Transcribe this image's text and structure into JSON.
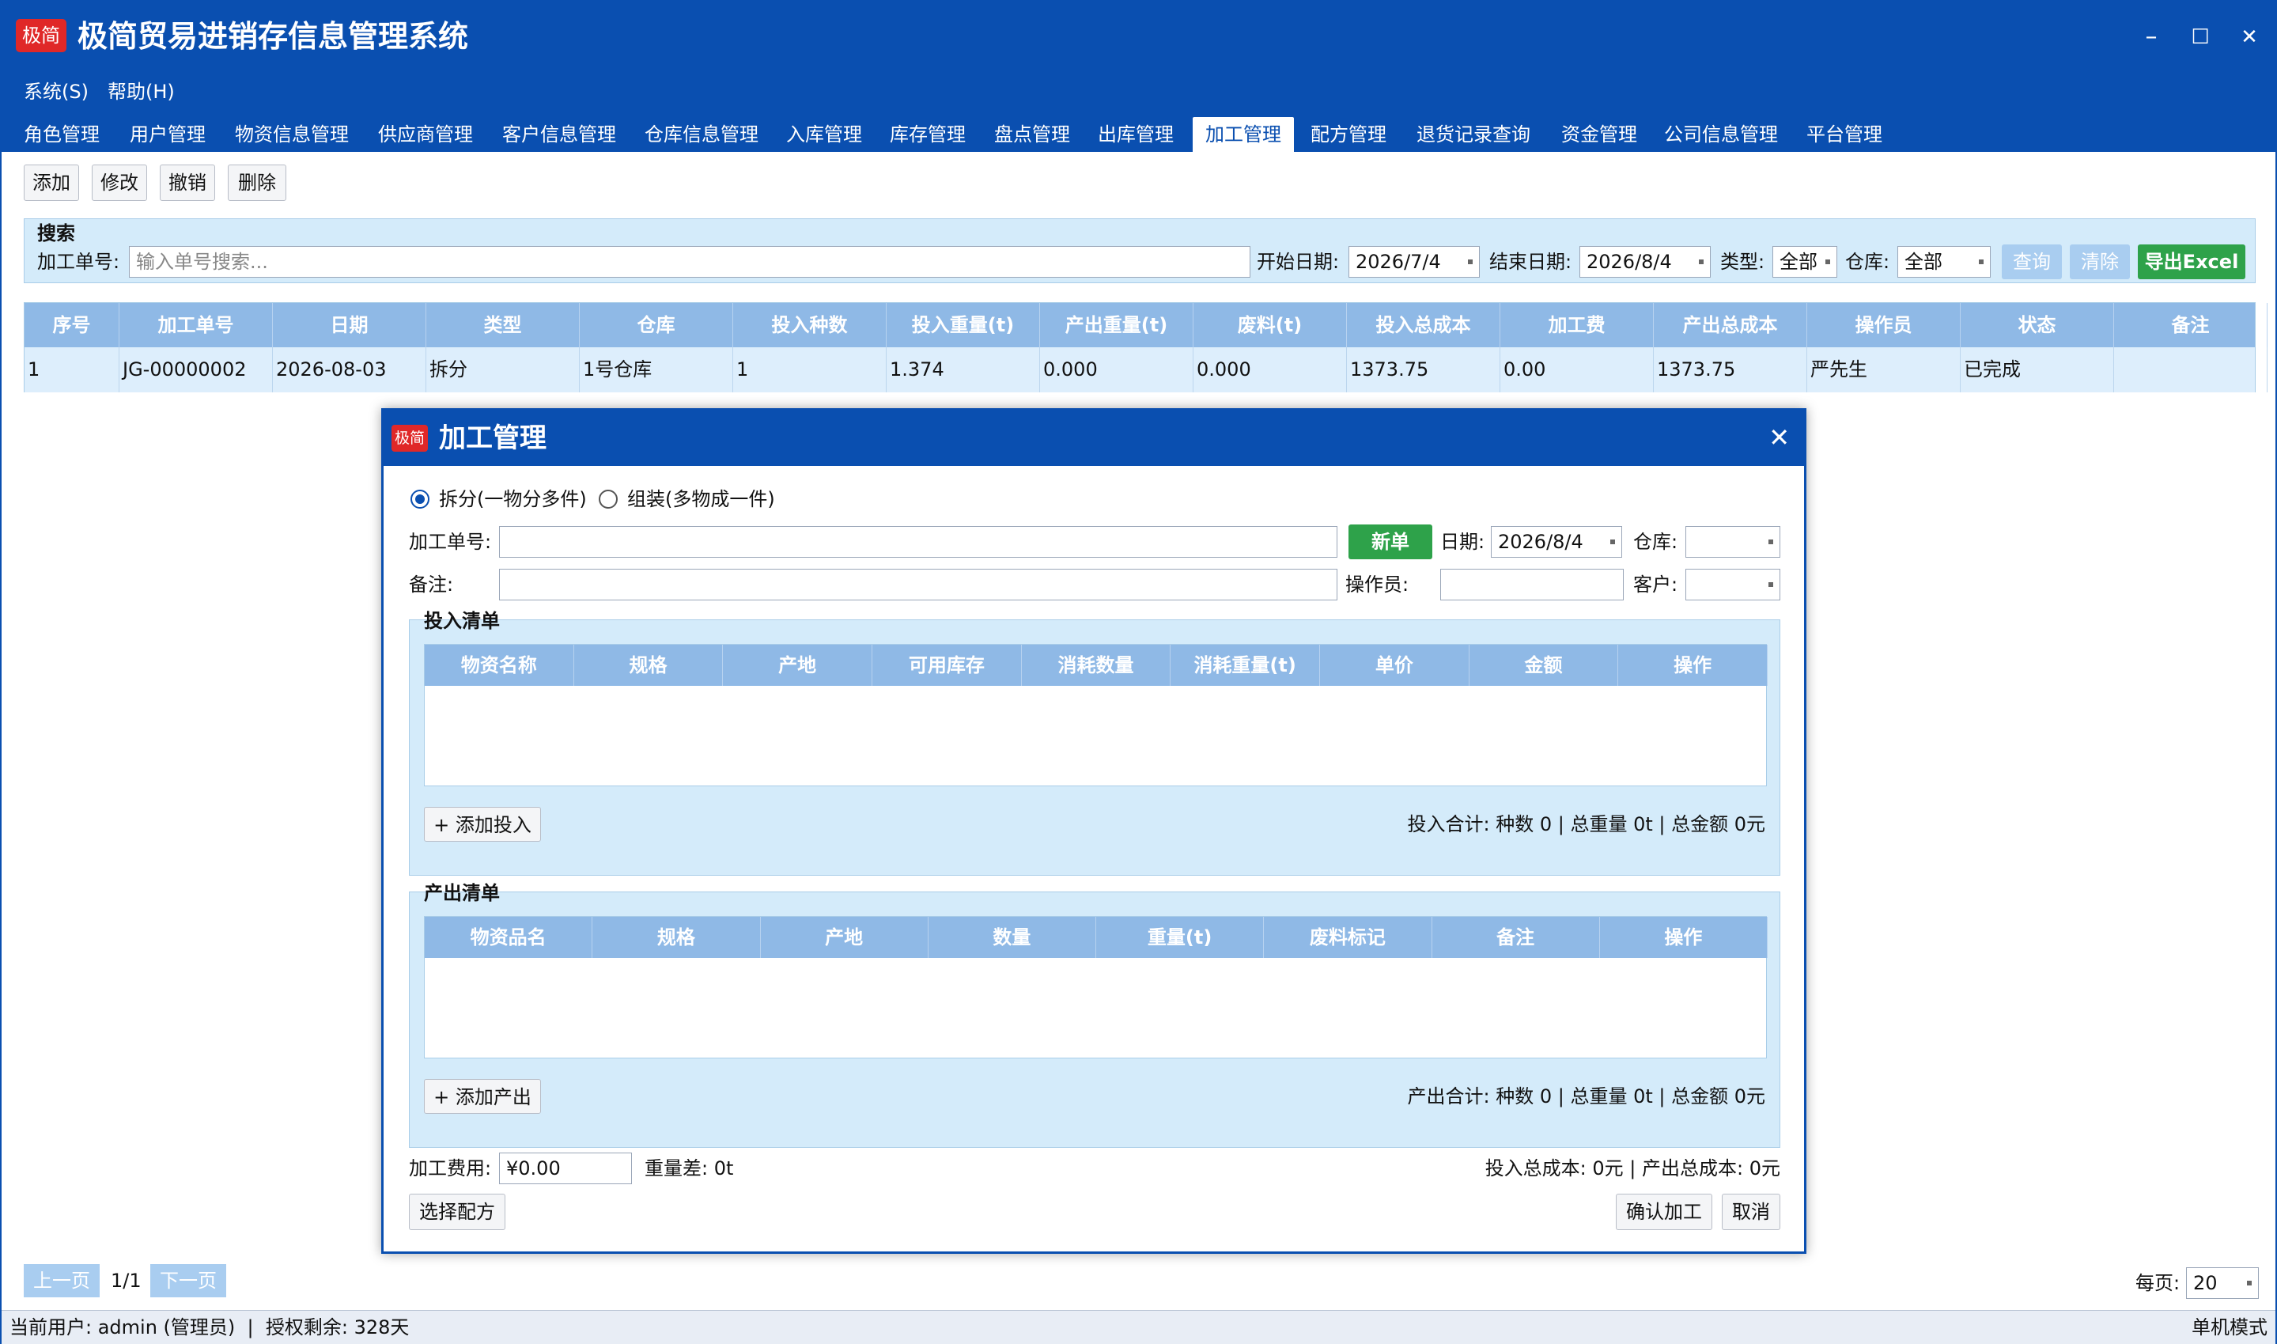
{
  "app": {
    "logo": "极简",
    "title": "极简贸易进销存信息管理系统",
    "win_min": "–",
    "win_max": "☐",
    "win_close": "✕"
  },
  "menu": [
    "系统(S)",
    "帮助(H)"
  ],
  "tabs": [
    "角色管理",
    "用户管理",
    "物资信息管理",
    "供应商管理",
    "客户信息管理",
    "仓库信息管理",
    "入库管理",
    "库存管理",
    "盘点管理",
    "出库管理",
    "加工管理",
    "配方管理",
    "退货记录查询",
    "资金管理",
    "公司信息管理",
    "平台管理"
  ],
  "active_tab": "加工管理",
  "toolbar": [
    "添加",
    "修改",
    "撤销",
    "删除"
  ],
  "search": {
    "title": "搜索",
    "order_label": "加工单号:",
    "order_placeholder": "输入单号搜索...",
    "start_label": "开始日期:",
    "start_value": "2026/7/4",
    "end_label": "结束日期:",
    "end_value": "2026/8/4",
    "type_label": "类型:",
    "type_value": "全部",
    "wh_label": "仓库:",
    "wh_value": "全部",
    "query": "查询",
    "clear": "清除",
    "export": "导出Excel"
  },
  "table": {
    "headers": [
      "序号",
      "加工单号",
      "日期",
      "类型",
      "仓库",
      "投入种数",
      "投入重量(t)",
      "产出重量(t)",
      "废料(t)",
      "投入总成本",
      "加工费",
      "产出总成本",
      "操作员",
      "状态",
      "备注"
    ],
    "rows": [
      [
        "1",
        "JG-00000002",
        "2026-08-03",
        "拆分",
        "1号仓库",
        "1",
        "1.374",
        "0.000",
        "0.000",
        "1373.75",
        "0.00",
        "1373.75",
        "严先生",
        "已完成",
        ""
      ]
    ]
  },
  "pager": {
    "prev": "上一页",
    "page": "1/1",
    "next": "下一页",
    "per_label": "每页:",
    "per_value": "20"
  },
  "status": {
    "left": "当前用户: admin (管理员)  |  授权剩余: 328天",
    "right": "单机模式"
  },
  "dialog": {
    "logo": "极简",
    "title": "加工管理",
    "close": "✕",
    "radio_split": "拆分(一物分多件)",
    "radio_assemble": "组装(多物成一件)",
    "order_label": "加工单号:",
    "order_value": "",
    "new_btn": "新单",
    "date_label": "日期:",
    "date_value": "2026/8/4",
    "wh_label": "仓库:",
    "wh_value": "",
    "note_label": "备注:",
    "note_value": "",
    "op_label": "操作员:",
    "op_value": "",
    "cust_label": "客户:",
    "cust_value": "",
    "input_title": "投入清单",
    "input_headers": [
      "物资名称",
      "规格",
      "产地",
      "可用库存",
      "消耗数量",
      "消耗重量(t)",
      "单价",
      "金额",
      "操作"
    ],
    "add_input": "+ 添加投入",
    "input_sum": "投入合计: 种数 0 | 总重量 0t | 总金额 0元",
    "output_title": "产出清单",
    "output_headers": [
      "物资品名",
      "规格",
      "产地",
      "数量",
      "重量(t)",
      "废料标记",
      "备注",
      "操作"
    ],
    "add_output": "+ 添加产出",
    "output_sum": "产出合计: 种数 0 | 总重量 0t | 总金额 0元",
    "fee_label": "加工费用:",
    "fee_value": "¥0.00",
    "weight_diff": "重量差: 0t",
    "cost_sum": "投入总成本: 0元 | 产出总成本: 0元",
    "formula_btn": "选择配方",
    "confirm_btn": "确认加工",
    "cancel_btn": "取消"
  },
  "colors": {
    "primary": "#0a4fb0",
    "header": "#8fb9e6",
    "panel": "#d4ebfa",
    "green": "#2ea24a",
    "logo_red": "#e02828"
  }
}
